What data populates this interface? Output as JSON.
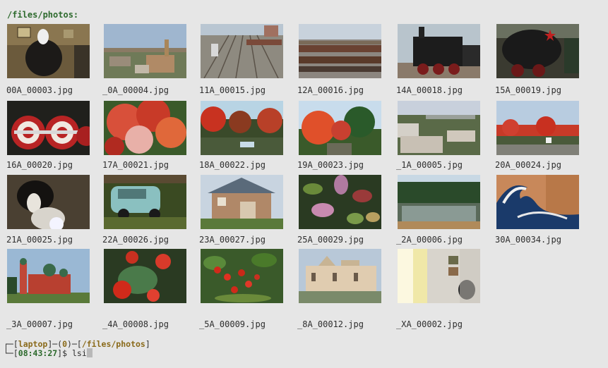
{
  "terminal": {
    "current_dir_header": "/files/photos:",
    "photos": [
      {
        "filename": "00A_00003.jpg",
        "scene": "mask-statue"
      },
      {
        "filename": "_0A_00004.jpg",
        "scene": "city-aerial"
      },
      {
        "filename": "11A_00015.jpg",
        "scene": "rail-yard"
      },
      {
        "filename": "12A_00016.jpg",
        "scene": "freight-yard"
      },
      {
        "filename": "14A_00018.jpg",
        "scene": "steam-locomotive"
      },
      {
        "filename": "15A_00019.jpg",
        "scene": "steam-locomotive-star"
      },
      {
        "filename": "16A_00020.jpg",
        "scene": "locomotive-wheels"
      },
      {
        "filename": "17A_00021.jpg",
        "scene": "autumn-tree"
      },
      {
        "filename": "18A_00022.jpg",
        "scene": "autumn-pond"
      },
      {
        "filename": "19A_00023.jpg",
        "scene": "autumn-forest"
      },
      {
        "filename": "_1A_00005.jpg",
        "scene": "city-blocks"
      },
      {
        "filename": "20A_00024.jpg",
        "scene": "autumn-road"
      },
      {
        "filename": "21A_00025.jpg",
        "scene": "dog"
      },
      {
        "filename": "22A_00026.jpg",
        "scene": "old-car"
      },
      {
        "filename": "23A_00027.jpg",
        "scene": "wooden-house"
      },
      {
        "filename": "25A_00029.jpg",
        "scene": "leaves"
      },
      {
        "filename": "_2A_00006.jpg",
        "scene": "quarry-lake"
      },
      {
        "filename": "30A_00034.jpg",
        "scene": "great-wave-mural"
      },
      {
        "filename": "_3A_00007.jpg",
        "scene": "red-church"
      },
      {
        "filename": "_4A_00008.jpg",
        "scene": "tomatoes"
      },
      {
        "filename": "_5A_00009.jpg",
        "scene": "strawberries"
      },
      {
        "filename": "_8A_00012.jpg",
        "scene": "palace"
      },
      {
        "filename": "_XA_00002.jpg",
        "scene": "gallery-interior"
      }
    ]
  },
  "prompt": {
    "host": "laptop",
    "status": "0",
    "cwd": "/files/photos",
    "time": "08:43:27",
    "symbol": "$",
    "input_text": "lsi"
  },
  "colors": {
    "background": "#e6e6e6",
    "prompt_green": "#2d6a2d",
    "prompt_brown": "#8a6a1a",
    "text": "#2e2e2e"
  }
}
